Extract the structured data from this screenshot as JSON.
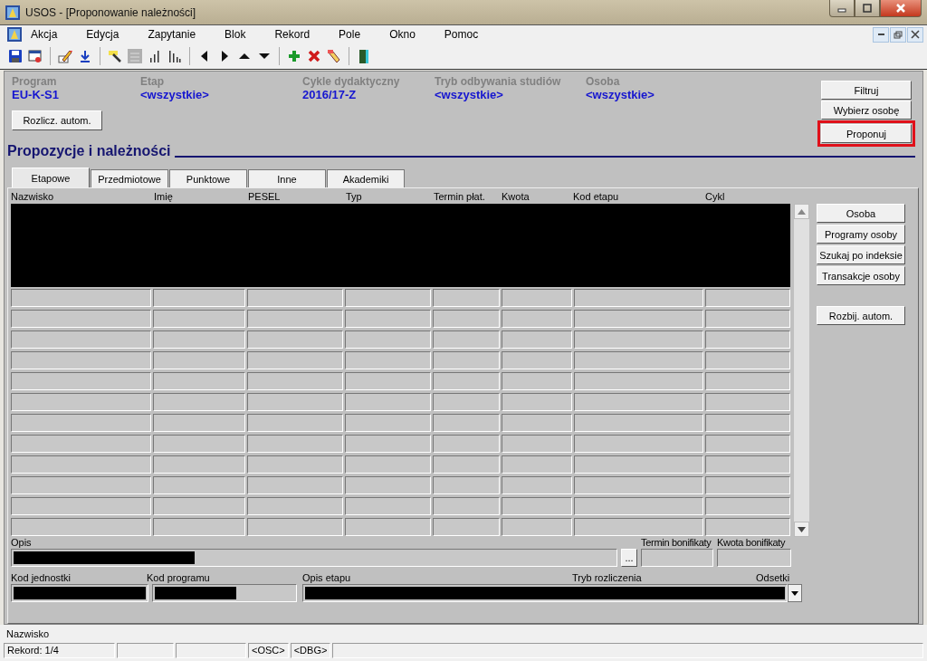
{
  "window": {
    "title": "USOS - [Proponowanie należności]"
  },
  "menu": [
    "Akcja",
    "Edycja",
    "Zapytanie",
    "Blok",
    "Rekord",
    "Pole",
    "Okno",
    "Pomoc"
  ],
  "header": {
    "fields": [
      {
        "label": "Program",
        "value": "EU-K-S1"
      },
      {
        "label": "Etap",
        "value": "<wszystkie>"
      },
      {
        "label": "Cykle dydaktyczny",
        "value": "2016/17-Z"
      },
      {
        "label": "Tryb odbywania studiów",
        "value": "<wszystkie>"
      },
      {
        "label": "Osoba",
        "value": "<wszystkie>"
      }
    ],
    "auto_button": "Rozlicz. autom.",
    "buttons": [
      {
        "label": "Filtruj",
        "highlighted": false
      },
      {
        "label": "Wybierz osobę",
        "highlighted": false
      },
      {
        "label": "Proponuj",
        "highlighted": true
      }
    ]
  },
  "section_title": "Propozycje i należności",
  "tabs": [
    {
      "label": "Etapowe",
      "selected": true
    },
    {
      "label": "Przedmiotowe",
      "selected": false
    },
    {
      "label": "Punktowe",
      "selected": false
    },
    {
      "label": "Inne",
      "selected": false
    },
    {
      "label": "Akademiki",
      "selected": false
    }
  ],
  "table": {
    "columns": [
      "Nazwisko",
      "Imię",
      "PESEL",
      "Typ",
      "Termin płat.",
      "Kwota",
      "Kod etapu",
      "Cykl"
    ],
    "rows": [
      {
        "redacted": true
      },
      {
        "redacted": true
      },
      {
        "redacted": true
      },
      {
        "redacted": true
      },
      {
        "redacted": false
      },
      {
        "redacted": false
      },
      {
        "redacted": false
      },
      {
        "redacted": false
      },
      {
        "redacted": false
      },
      {
        "redacted": false
      },
      {
        "redacted": false
      },
      {
        "redacted": false
      },
      {
        "redacted": false
      },
      {
        "redacted": false
      },
      {
        "redacted": false
      },
      {
        "redacted": false
      }
    ]
  },
  "side_buttons": [
    "Osoba",
    "Programy osoby",
    "Szukaj po indeksie",
    "Transakcje osoby"
  ],
  "split_button": "Rozbij. autom.",
  "details": {
    "opis": {
      "label": "Opis",
      "redacted": true
    },
    "more_button": "...",
    "termin_bonifikaty": "Termin bonifikaty",
    "kwota_bonifikaty": "Kwota bonifikaty",
    "kod_jednostki": {
      "label": "Kod jednostki",
      "redacted": true
    },
    "kod_programu": {
      "label": "Kod programu",
      "redacted": true
    },
    "opis_etapu": {
      "label": "Opis etapu",
      "redacted": true
    },
    "tryb_rozliczenia": "Tryb rozliczenia",
    "odsetki": "Odsetki"
  },
  "hint": "Nazwisko",
  "status_bar": {
    "record": "Rekord: 1/4",
    "cells": [
      "<OSC>",
      "<DBG>"
    ]
  }
}
